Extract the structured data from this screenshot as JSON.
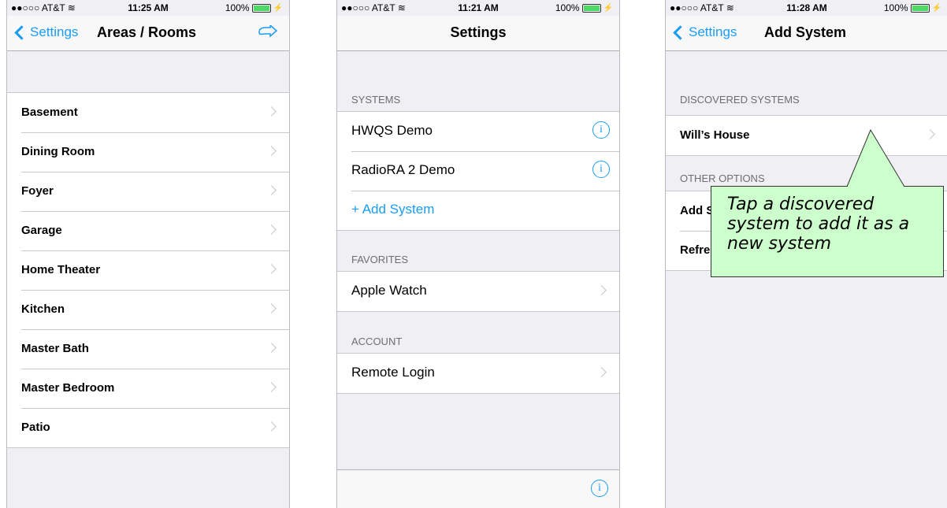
{
  "phones": [
    {
      "status": {
        "carrier": "●●○○○ AT&T ≋",
        "time": "11:25 AM",
        "battery": "100%"
      },
      "nav": {
        "back": "Settings",
        "title": "Areas / Rooms"
      },
      "rows": [
        "Basement",
        "Dining Room",
        "Foyer",
        "Garage",
        "Home Theater",
        "Kitchen",
        "Master Bath",
        "Master Bedroom",
        "Patio"
      ]
    },
    {
      "status": {
        "carrier": "●●○○○ AT&T ≋",
        "time": "11:21 AM",
        "battery": "100%"
      },
      "nav": {
        "title": "Settings"
      },
      "sections": {
        "systems": {
          "header": "SYSTEMS",
          "items": [
            "HWQS Demo",
            "RadioRA 2 Demo"
          ],
          "add": "+ Add System"
        },
        "favorites": {
          "header": "FAVORITES",
          "items": [
            "Apple Watch"
          ]
        },
        "account": {
          "header": "ACCOUNT",
          "items": [
            "Remote Login"
          ]
        }
      }
    },
    {
      "status": {
        "carrier": "●●○○○ AT&T ≋",
        "time": "11:28 AM",
        "battery": "100%"
      },
      "nav": {
        "back": "Settings",
        "title": "Add System"
      },
      "sections": {
        "discovered": {
          "header": "DISCOVERED SYSTEMS",
          "items": [
            "Will’s House"
          ]
        },
        "other": {
          "header": "OTHER OPTIONS",
          "items": [
            "Add S",
            "Refres"
          ]
        }
      }
    }
  ],
  "callout": {
    "text": "Tap a discovered system to add it as a new system"
  },
  "colors": {
    "accent": "#1a9cf1",
    "callout_bg": "#ccffcc",
    "battery": "#4cd964"
  }
}
